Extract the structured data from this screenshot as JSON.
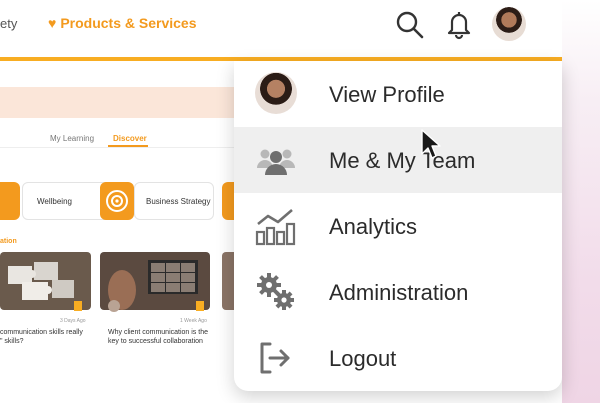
{
  "header": {
    "cut_nav": "ety",
    "products_label": "Products & Services",
    "icons": [
      "search-icon",
      "bell-icon"
    ],
    "accent": "#f8ad22"
  },
  "page": {
    "tabs": [
      "My Learning",
      "Discover"
    ],
    "categories": [
      "Wellbeing",
      "Business Strategy"
    ],
    "section_fragment": "ation",
    "cards": [
      {
        "date": "3 Days Ago",
        "title_line1": "communication skills really",
        "title_line2": "\" skills?"
      },
      {
        "date": "1 Week Ago",
        "title_line1": "Why client communication is the",
        "title_line2": "key to successful collaboration"
      }
    ]
  },
  "menu": {
    "items": [
      {
        "label": "View Profile",
        "icon": "avatar"
      },
      {
        "label": "Me & My Team",
        "icon": "team-icon"
      },
      {
        "label": "Analytics",
        "icon": "analytics-icon"
      },
      {
        "label": "Administration",
        "icon": "gears-icon"
      },
      {
        "label": "Logout",
        "icon": "logout-icon"
      }
    ]
  }
}
